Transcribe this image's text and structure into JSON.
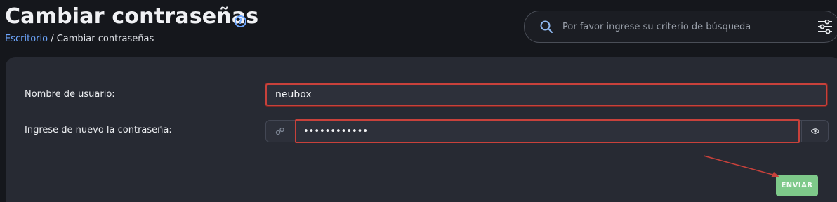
{
  "header": {
    "title": "Cambiar contraseñas",
    "help_icon": "question-circle-icon",
    "breadcrumb": {
      "home": "Escritorio",
      "separator": " / ",
      "current": "Cambiar contraseñas"
    }
  },
  "search": {
    "placeholder": "Por favor ingrese su criterio de búsqueda",
    "icon": "search-icon",
    "filter_icon": "sliders-icon"
  },
  "form": {
    "username": {
      "label": "Nombre de usuario:",
      "value": "neubox"
    },
    "password": {
      "label": "Ingrese de nuevo la contraseña:",
      "value": "••••••••••••",
      "prefix_icon": "key-icon",
      "suffix_icon": "eye-icon"
    },
    "submit_label": "ENVIAR"
  },
  "colors": {
    "accent": "#6ea7ff",
    "highlight": "#c8413b",
    "submit": "#7ec98a",
    "background": "#15171c",
    "card": "#272a33"
  }
}
